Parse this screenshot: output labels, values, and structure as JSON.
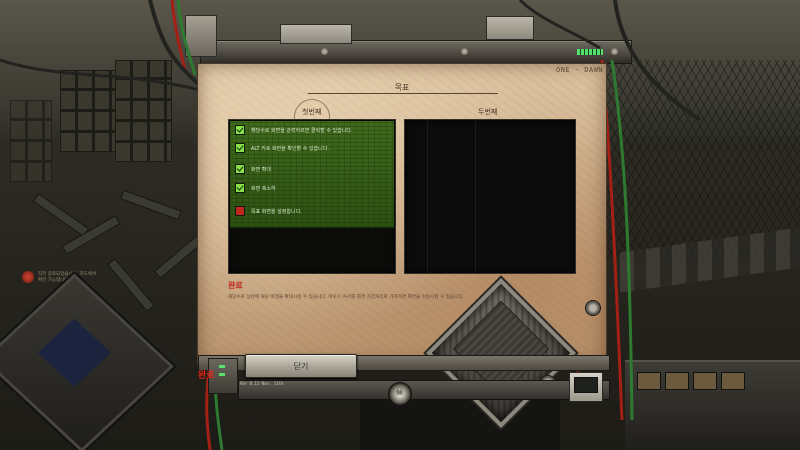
{
  "panel": {
    "title": "목표",
    "col1_label": "첫번째",
    "col2_label": "두번째",
    "objectives": [
      {
        "text": "해당수로 화면을 강력하르면 클릭할 수 있습니다.",
        "checked": true
      },
      {
        "text": "ALT 키로 화면을 확인할 수 있습니다.",
        "checked": true
      },
      {
        "text": "화면 확대",
        "checked": true
      },
      {
        "text": "화면 축소하",
        "checked": true
      },
      {
        "text": "목표 화면을 설정합니다.",
        "checked": false
      }
    ],
    "section_title": "완료",
    "section_desc": "해당수로 상관에 해당 비행을 확대시킬 수 있습니다. 마우스 커서를 화면 가장자리로 가져가면 화면을 이동시킬 수 있습니다.",
    "close_label": "닫기"
  },
  "hud": {
    "version_text": "ONE · DAWN",
    "tag": "완료",
    "bottom_tiny": "Ver 0.11 Nov. 11th",
    "left_notice": "작전 종료되었습니다. 지도에서 확인 가능합니다."
  },
  "colors": {
    "accent_red": "#c0281c",
    "check_green": "#8be04a",
    "list_green": "#3f6a1c",
    "paper": "#dcc3a0"
  }
}
